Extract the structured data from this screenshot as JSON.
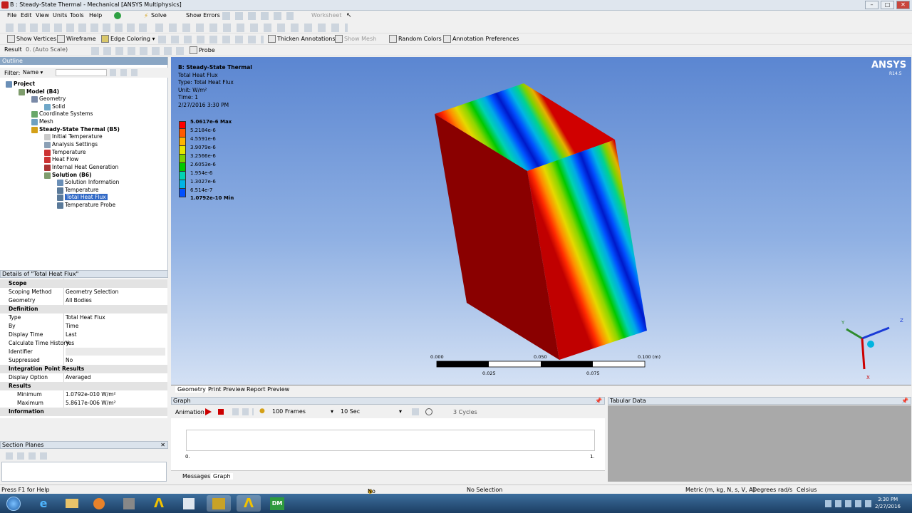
{
  "window": {
    "title": "B : Steady-State Thermal - Mechanical [ANSYS Multiphysics]"
  },
  "menu": [
    "File",
    "Edit",
    "View",
    "Units",
    "Tools",
    "Help"
  ],
  "toolbar1": {
    "solve": "Solve",
    "show_errors": "Show Errors",
    "worksheet": "Worksheet"
  },
  "toolbar2": {
    "show_vertices": "Show Vertices",
    "wireframe": "Wireframe",
    "edge_coloring": "Edge Coloring",
    "thicken_annotations": "Thicken Annotations",
    "show_mesh": "Show Mesh",
    "random_colors": "Random Colors",
    "annotation_preferences": "Annotation Preferences"
  },
  "toolbar3": {
    "result_label": "Result",
    "scale_value": "0. (Auto Scale)",
    "probe": "Probe"
  },
  "outline": {
    "header": "Outline",
    "filter_label": "Filter:",
    "filter_value": "Name",
    "nodes": [
      "Project",
      "Model (B4)",
      "Geometry",
      "Solid",
      "Coordinate Systems",
      "Mesh",
      "Steady-State Thermal (B5)",
      "Initial Temperature",
      "Analysis Settings",
      "Temperature",
      "Heat Flow",
      "Internal Heat Generation",
      "Solution (B6)",
      "Solution Information",
      "Temperature",
      "Total Heat Flux",
      "Temperature Probe"
    ]
  },
  "details": {
    "header": "Details of \"Total Heat Flux\"",
    "sections": {
      "scope": "Scope",
      "definition": "Definition",
      "integration": "Integration Point Results",
      "results": "Results",
      "information": "Information"
    },
    "rows": [
      {
        "k": "Scoping Method",
        "v": "Geometry Selection"
      },
      {
        "k": "Geometry",
        "v": "All Bodies"
      },
      {
        "k": "Type",
        "v": "Total Heat Flux"
      },
      {
        "k": "By",
        "v": "Time"
      },
      {
        "k": "Display Time",
        "v": "Last"
      },
      {
        "k": "Calculate Time History",
        "v": "Yes"
      },
      {
        "k": "Identifier",
        "v": ""
      },
      {
        "k": "Suppressed",
        "v": "No"
      },
      {
        "k": "Display Option",
        "v": "Averaged"
      },
      {
        "k": "Minimum",
        "v": "1.0792e-010 W/m²"
      },
      {
        "k": "Maximum",
        "v": "5.8617e-006 W/m²"
      }
    ]
  },
  "section_planes": {
    "header": "Section Planes"
  },
  "viewport": {
    "info": {
      "title": "B: Steady-State Thermal",
      "name": "Total Heat Flux",
      "type": "Type: Total Heat Flux",
      "unit": "Unit: W/m²",
      "time": "Time: 1",
      "date": "2/27/2016 3:30 PM"
    },
    "legend": [
      "5.0617e-6 Max",
      "5.2184e-6",
      "4.5591e-6",
      "3.9079e-6",
      "3.2566e-6",
      "2.6053e-6",
      "1.954e-6",
      "1.3027e-6",
      "6.514e-7",
      "1.0792e-10 Min"
    ],
    "legend_colors": [
      "#ff0000",
      "#ff5a00",
      "#ffb400",
      "#e6e600",
      "#7cd200",
      "#00c800",
      "#00d2b4",
      "#00b4e6",
      "#0050ff",
      "#0000c8"
    ],
    "brand": "ANSYS",
    "version": "R14.5",
    "scale": {
      "t0": "0.000",
      "t1": "0.050",
      "t2": "0.100 (m)",
      "t3": "0.025",
      "t4": "0.075"
    },
    "axes": {
      "x": "X",
      "y": "Y",
      "z": "Z"
    }
  },
  "view_tabs": [
    "Geometry",
    "Print Preview",
    "Report Preview"
  ],
  "graph": {
    "header": "Graph",
    "animation": "Animation",
    "frames": "100 Frames",
    "duration": "10 Sec",
    "cycles": "3 Cycles",
    "x0": "0.",
    "x1": "1."
  },
  "tabular": {
    "header": "Tabular Data"
  },
  "bottom_tabs": [
    "Messages",
    "Graph"
  ],
  "status": {
    "help": "Press F1 for Help",
    "messages": "No Messages",
    "selection": "No Selection",
    "units": "Metric (m, kg, N, s, V, A)",
    "deg": "Degrees",
    "rad": "rad/s",
    "celsius": "Celsius"
  },
  "clock": {
    "time": "3:30 PM",
    "date": "2/27/2016"
  }
}
